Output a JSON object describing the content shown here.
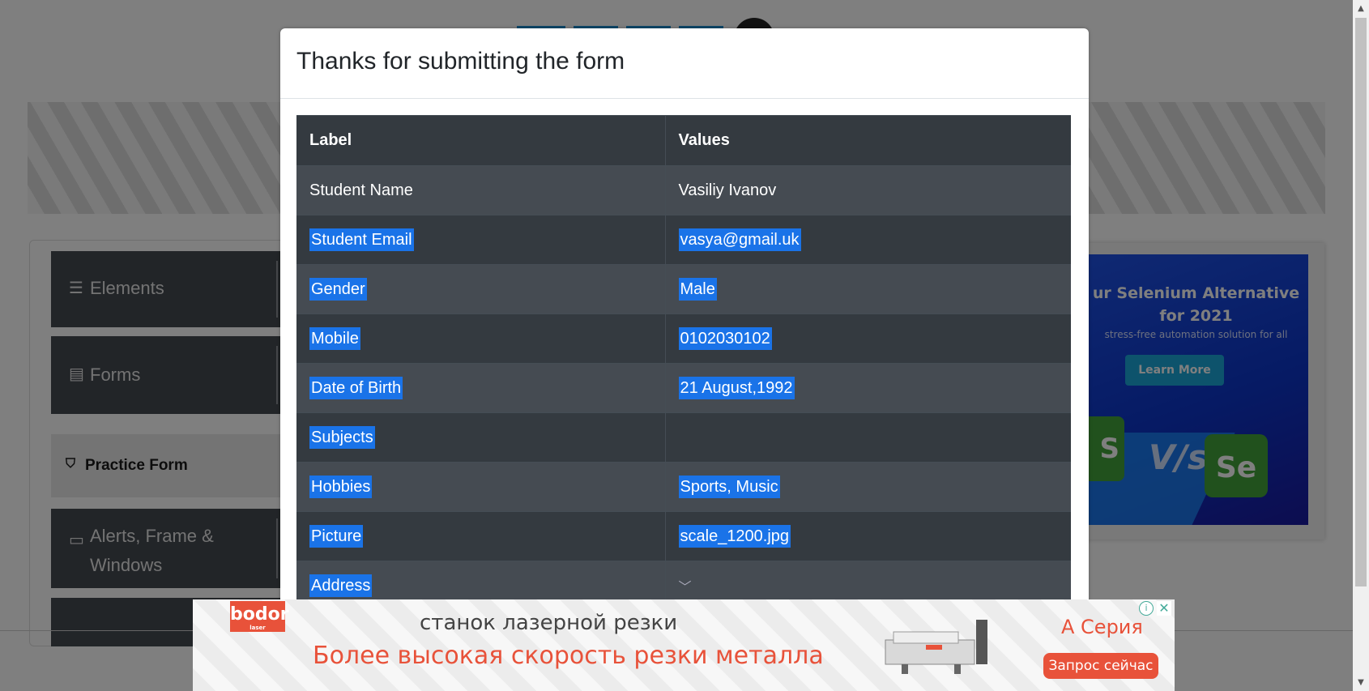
{
  "modal": {
    "title": "Thanks for submitting the form",
    "table": {
      "headers": [
        "Label",
        "Values"
      ],
      "rows": [
        {
          "label": "Student Name",
          "value": "Vasiliy Ivanov"
        },
        {
          "label": "Student Email",
          "value": "vasya@gmail.uk"
        },
        {
          "label": "Gender",
          "value": "Male"
        },
        {
          "label": "Mobile",
          "value": "0102030102"
        },
        {
          "label": "Date of Birth",
          "value": "21 August,1992"
        },
        {
          "label": "Subjects",
          "value": ""
        },
        {
          "label": "Hobbies",
          "value": "Sports, Music"
        },
        {
          "label": "Picture",
          "value": "scale_1200.jpg"
        },
        {
          "label": "Address",
          "value": ""
        }
      ]
    }
  },
  "sidebar": {
    "groups": [
      {
        "label": "Elements",
        "icon": "hamburger-icon"
      },
      {
        "label": "Forms",
        "icon": "document-icon"
      },
      {
        "label": "Alerts, Frame & Windows",
        "icon": "window-icon"
      }
    ],
    "active_item": {
      "label": "Practice Form",
      "icon": "html5-icon"
    }
  },
  "side_ad": {
    "headline": "ur Selenium Alternative for 2021",
    "subtext": "stress-free automation solution for all",
    "button": "Learn More",
    "vs": "V/s",
    "se": "Se",
    "s": "S"
  },
  "bottom_ad": {
    "brand": "bodor",
    "brand_sub": "laser",
    "line1": "станок лазерной резки",
    "line2": "Более высокая скорость резки металла",
    "series": "А Серия",
    "cta": "Запрос сейчас"
  },
  "colors": {
    "overlay": "rgba(0,0,0,0.5)",
    "table_dark": "#343a40",
    "table_stripe": "#454b52",
    "selection": "#1a73e8",
    "ad_accent": "#e8523a"
  }
}
